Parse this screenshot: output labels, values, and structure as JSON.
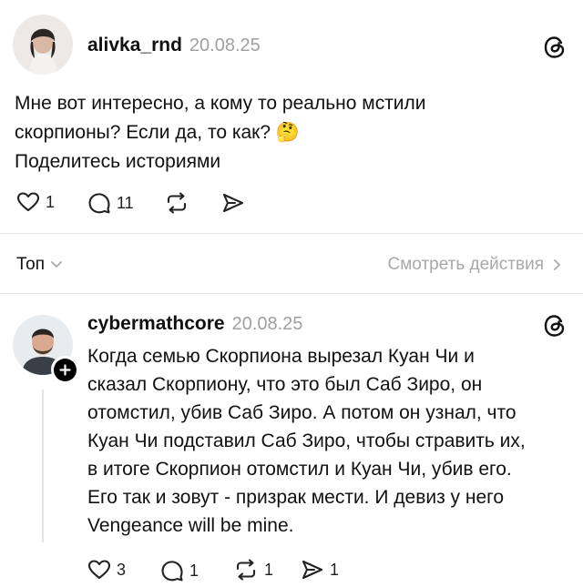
{
  "post": {
    "username": "alivka_rnd",
    "date": "20.08.25",
    "text_line1": "Мне вот интересно, а кому то реально мстили",
    "text_line2": "скорпионы? Если да, то как?",
    "emoji": "🤔",
    "text_line3": "Поделитесь историями",
    "likes": "1",
    "comments": "11"
  },
  "sort_bar": {
    "sort_label": "Топ",
    "view_activity_label": "Смотреть действия"
  },
  "reply": {
    "username": "cybermathcore",
    "date": "20.08.25",
    "lines": [
      "Когда семью Скорпиона вырезал Куан Чи и",
      "сказал Скорпиону, что это был Саб Зиро, он",
      "отомстил, убив Саб Зиро. А потом он узнал, что",
      "Куан Чи подставил Саб Зиро, чтобы стравить их,",
      "в итоге Скорпион отомстил и Куан Чи, убив его.",
      "Его так и зовут - призрак мести. И девиз у него",
      "Vengeance will be mine."
    ],
    "likes": "3",
    "comments": "1",
    "reposts": "1",
    "shares": "1"
  },
  "colors": {
    "muted": "#a0a0a0",
    "text": "#111111",
    "divider": "#e6e6e6"
  },
  "icons": [
    "threads-logo-icon",
    "heart-icon",
    "comment-icon",
    "repost-icon",
    "share-icon",
    "chevron-down-icon",
    "chevron-right-icon",
    "plus-icon"
  ]
}
